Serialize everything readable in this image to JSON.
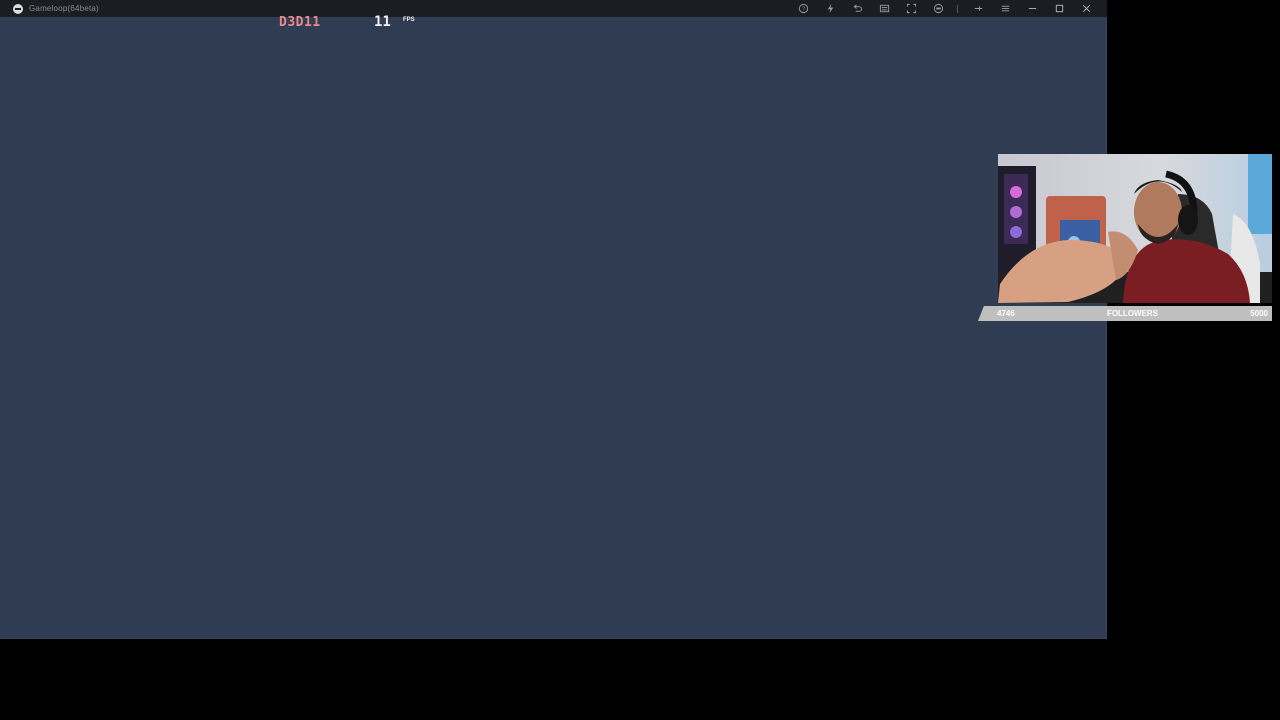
{
  "window": {
    "title": "Gameloop(64beta)",
    "background": "#303c51",
    "toolbar_icons": [
      "help-icon",
      "boost-icon",
      "undo-icon",
      "keyboard-icon",
      "fullscreen-icon",
      "gamepad-icon",
      "pin-icon",
      "menu-icon",
      "minimize-icon",
      "maximize-icon",
      "close-icon"
    ]
  },
  "overlay": {
    "renderer": "D3D11",
    "fps_value": "11",
    "fps_unit": "FPS"
  },
  "stream": {
    "followers_current": "4746",
    "followers_label": "FOLLOWERS",
    "followers_goal": "5000",
    "followers_progress": 0.9492
  }
}
